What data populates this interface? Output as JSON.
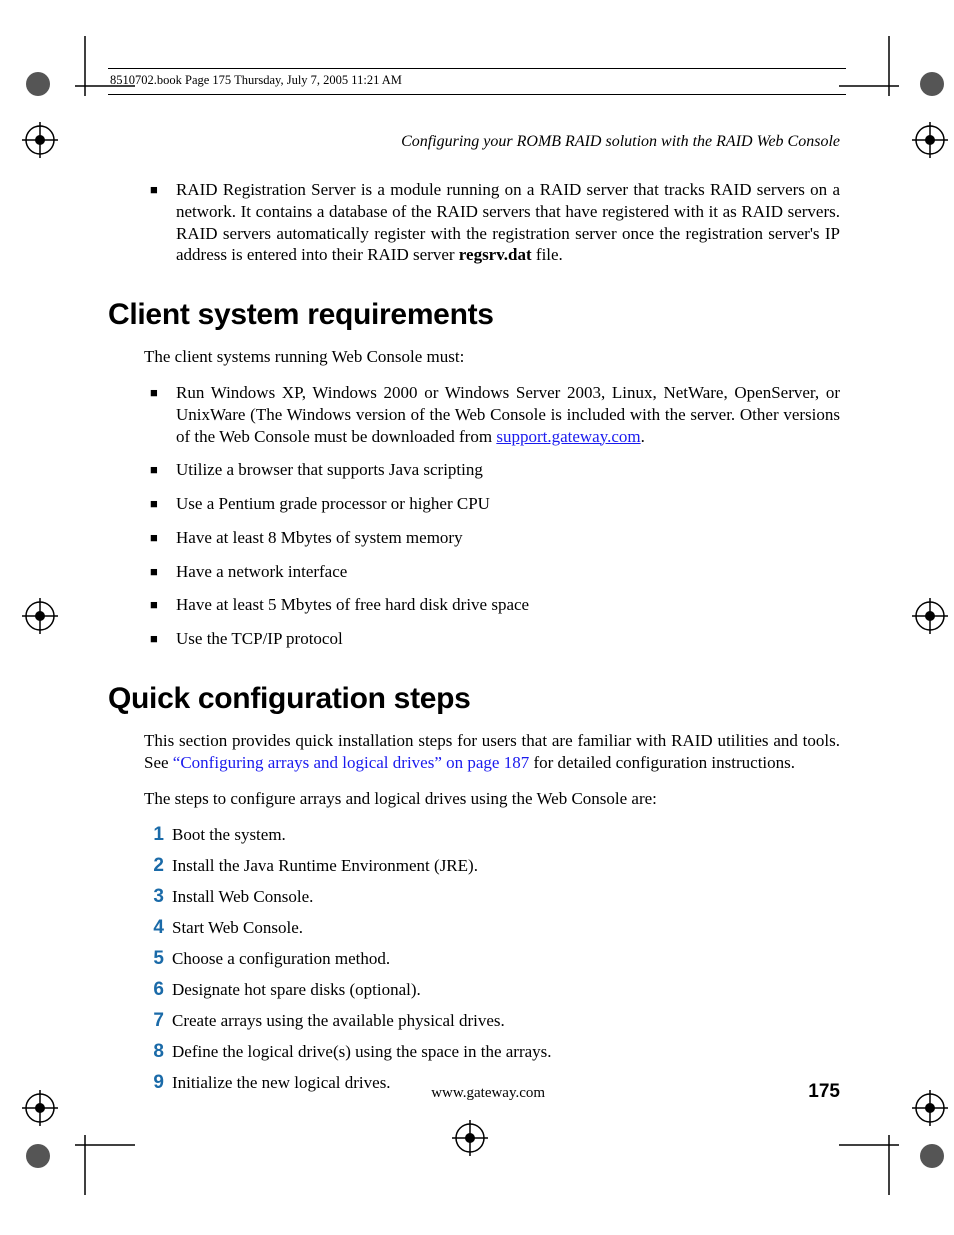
{
  "book_info": "8510702.book  Page 175  Thursday, July 7, 2005  11:21 AM",
  "running_head": "Configuring your ROMB RAID solution with the RAID Web Console",
  "intro_bullet": {
    "pre": "RAID Registration Server is a module running on a RAID server that tracks RAID servers on a network. It contains a database of the RAID servers that have registered with it as RAID servers. RAID servers automatically register with the registration server once the registration server's IP address is entered into their RAID server ",
    "bold": "regsrv.dat",
    "post": " file."
  },
  "heading1": "Client system requirements",
  "para1": "The client systems running Web Console must:",
  "req_bullets": [
    {
      "pre": "Run Windows XP, Windows 2000 or Windows Server 2003, Linux, NetWare, OpenServer, or UnixWare (The Windows version of the Web Console is included with the server. Other versions of the Web Console must be downloaded from ",
      "link": "support.gateway.com",
      "post": "."
    },
    {
      "text": "Utilize a browser that supports Java scripting"
    },
    {
      "text": "Use a Pentium grade processor or higher CPU"
    },
    {
      "text": "Have at least 8 Mbytes of system memory"
    },
    {
      "text": "Have a network interface"
    },
    {
      "text": "Have at least 5 Mbytes of free hard disk drive space"
    },
    {
      "text": "Use the TCP/IP protocol"
    }
  ],
  "heading2": "Quick configuration steps",
  "para2_pre": "This section provides quick installation steps for users that are familiar with RAID utilities and tools. See ",
  "para2_xref": "“Configuring arrays and logical drives” on page 187",
  "para2_post": " for detailed configuration instructions.",
  "para3": "The steps to configure arrays and logical drives using the Web Console are:",
  "steps": [
    "Boot the system.",
    "Install the Java Runtime Environment (JRE).",
    "Install Web Console.",
    "Start Web Console.",
    "Choose a configuration method.",
    "Designate hot spare disks (optional).",
    "Create arrays using the available physical drives.",
    "Define the logical drive(s) using the space in the arrays.",
    "Initialize the new logical drives."
  ],
  "footer_url": "www.gateway.com",
  "footer_page": "175"
}
